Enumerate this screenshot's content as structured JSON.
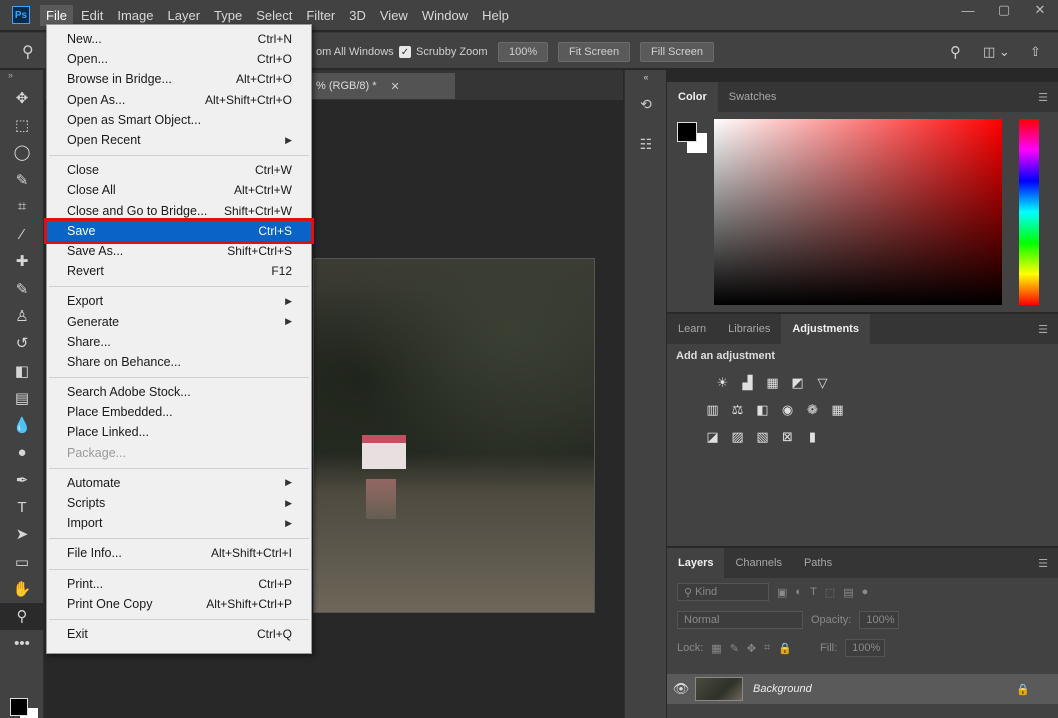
{
  "app": {
    "logo": "Ps"
  },
  "menubar": {
    "items": [
      "File",
      "Edit",
      "Image",
      "Layer",
      "Type",
      "Select",
      "Filter",
      "3D",
      "View",
      "Window",
      "Help"
    ],
    "window_controls": [
      "—",
      "▢",
      "✕"
    ]
  },
  "optionsbar": {
    "zoom_all_windows": "om All Windows",
    "scrubby_zoom": "Scrubby Zoom",
    "zoom_percent": "100%",
    "fit_screen": "Fit Screen",
    "fill_screen": "Fill Screen"
  },
  "document": {
    "tab_label": "% (RGB/8) *",
    "tab_close": "✕"
  },
  "file_menu": {
    "groups": [
      [
        {
          "label": "New...",
          "shortcut": "Ctrl+N"
        },
        {
          "label": "Open...",
          "shortcut": "Ctrl+O"
        },
        {
          "label": "Browse in Bridge...",
          "shortcut": "Alt+Ctrl+O"
        },
        {
          "label": "Open As...",
          "shortcut": "Alt+Shift+Ctrl+O"
        },
        {
          "label": "Open as Smart Object...",
          "shortcut": ""
        },
        {
          "label": "Open Recent",
          "shortcut": "",
          "submenu": true
        }
      ],
      [
        {
          "label": "Close",
          "shortcut": "Ctrl+W"
        },
        {
          "label": "Close All",
          "shortcut": "Alt+Ctrl+W"
        },
        {
          "label": "Close and Go to Bridge...",
          "shortcut": "Shift+Ctrl+W"
        },
        {
          "label": "Save",
          "shortcut": "Ctrl+S",
          "highlighted": true
        },
        {
          "label": "Save As...",
          "shortcut": "Shift+Ctrl+S"
        },
        {
          "label": "Revert",
          "shortcut": "F12"
        }
      ],
      [
        {
          "label": "Export",
          "shortcut": "",
          "submenu": true
        },
        {
          "label": "Generate",
          "shortcut": "",
          "submenu": true
        },
        {
          "label": "Share...",
          "shortcut": ""
        },
        {
          "label": "Share on Behance...",
          "shortcut": ""
        }
      ],
      [
        {
          "label": "Search Adobe Stock...",
          "shortcut": ""
        },
        {
          "label": "Place Embedded...",
          "shortcut": ""
        },
        {
          "label": "Place Linked...",
          "shortcut": ""
        },
        {
          "label": "Package...",
          "shortcut": "",
          "disabled": true
        }
      ],
      [
        {
          "label": "Automate",
          "shortcut": "",
          "submenu": true
        },
        {
          "label": "Scripts",
          "shortcut": "",
          "submenu": true
        },
        {
          "label": "Import",
          "shortcut": "",
          "submenu": true
        }
      ],
      [
        {
          "label": "File Info...",
          "shortcut": "Alt+Shift+Ctrl+I"
        }
      ],
      [
        {
          "label": "Print...",
          "shortcut": "Ctrl+P"
        },
        {
          "label": "Print One Copy",
          "shortcut": "Alt+Shift+Ctrl+P"
        }
      ],
      [
        {
          "label": "Exit",
          "shortcut": "Ctrl+Q"
        }
      ]
    ]
  },
  "color_panel": {
    "tabs": [
      "Color",
      "Swatches"
    ]
  },
  "adjustments_panel": {
    "tabs": [
      "Learn",
      "Libraries",
      "Adjustments"
    ],
    "title": "Add an adjustment"
  },
  "layers_panel": {
    "tabs": [
      "Layers",
      "Channels",
      "Paths"
    ],
    "kind_label": "Kind",
    "blend_mode": "Normal",
    "opacity_label": "Opacity:",
    "opacity_value": "100%",
    "lock_label": "Lock:",
    "fill_label": "Fill:",
    "fill_value": "100%",
    "layer_name": "Background"
  },
  "colors": {
    "accent": "#0a64c8",
    "highlight_outline": "#e01010"
  }
}
